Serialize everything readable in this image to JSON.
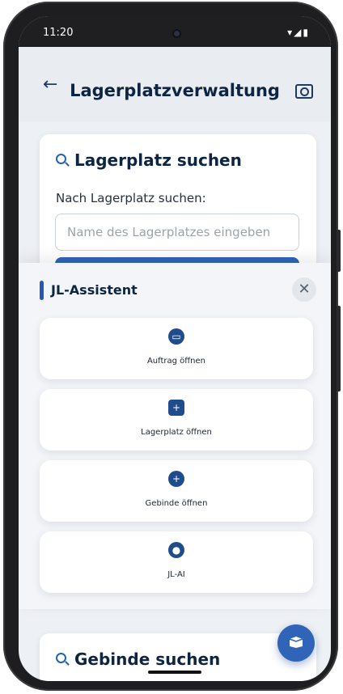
{
  "status_bar": {
    "time": "11:20",
    "icons": "▾◢▮"
  },
  "app_bar": {
    "back_glyph": "←",
    "title": "Lagerplatzverwaltung"
  },
  "lagerplatz_card": {
    "title": "Lagerplatz suchen",
    "field_label": "Nach Lagerplatz suchen:",
    "input_placeholder": "Name des Lagerplatzes eingeben",
    "input_value": ""
  },
  "assistant": {
    "title": "JL-Assistent",
    "close_glyph": "✕",
    "actions": [
      {
        "label": "Auftrag öffnen",
        "icon": "box-icon",
        "glyph": "▭"
      },
      {
        "label": "Lagerplatz öffnen",
        "icon": "cart-plus-icon",
        "glyph": "+"
      },
      {
        "label": "Gebinde öffnen",
        "icon": "plus-circle-icon",
        "glyph": "+"
      },
      {
        "label": "JL-AI",
        "icon": "location-pin-icon",
        "glyph": "●"
      }
    ]
  },
  "gebinde_card": {
    "title": "Gebinde suchen"
  },
  "colors": {
    "accent": "#2f64b8",
    "dark_navy": "#0d2540",
    "background": "#edf0f4"
  }
}
